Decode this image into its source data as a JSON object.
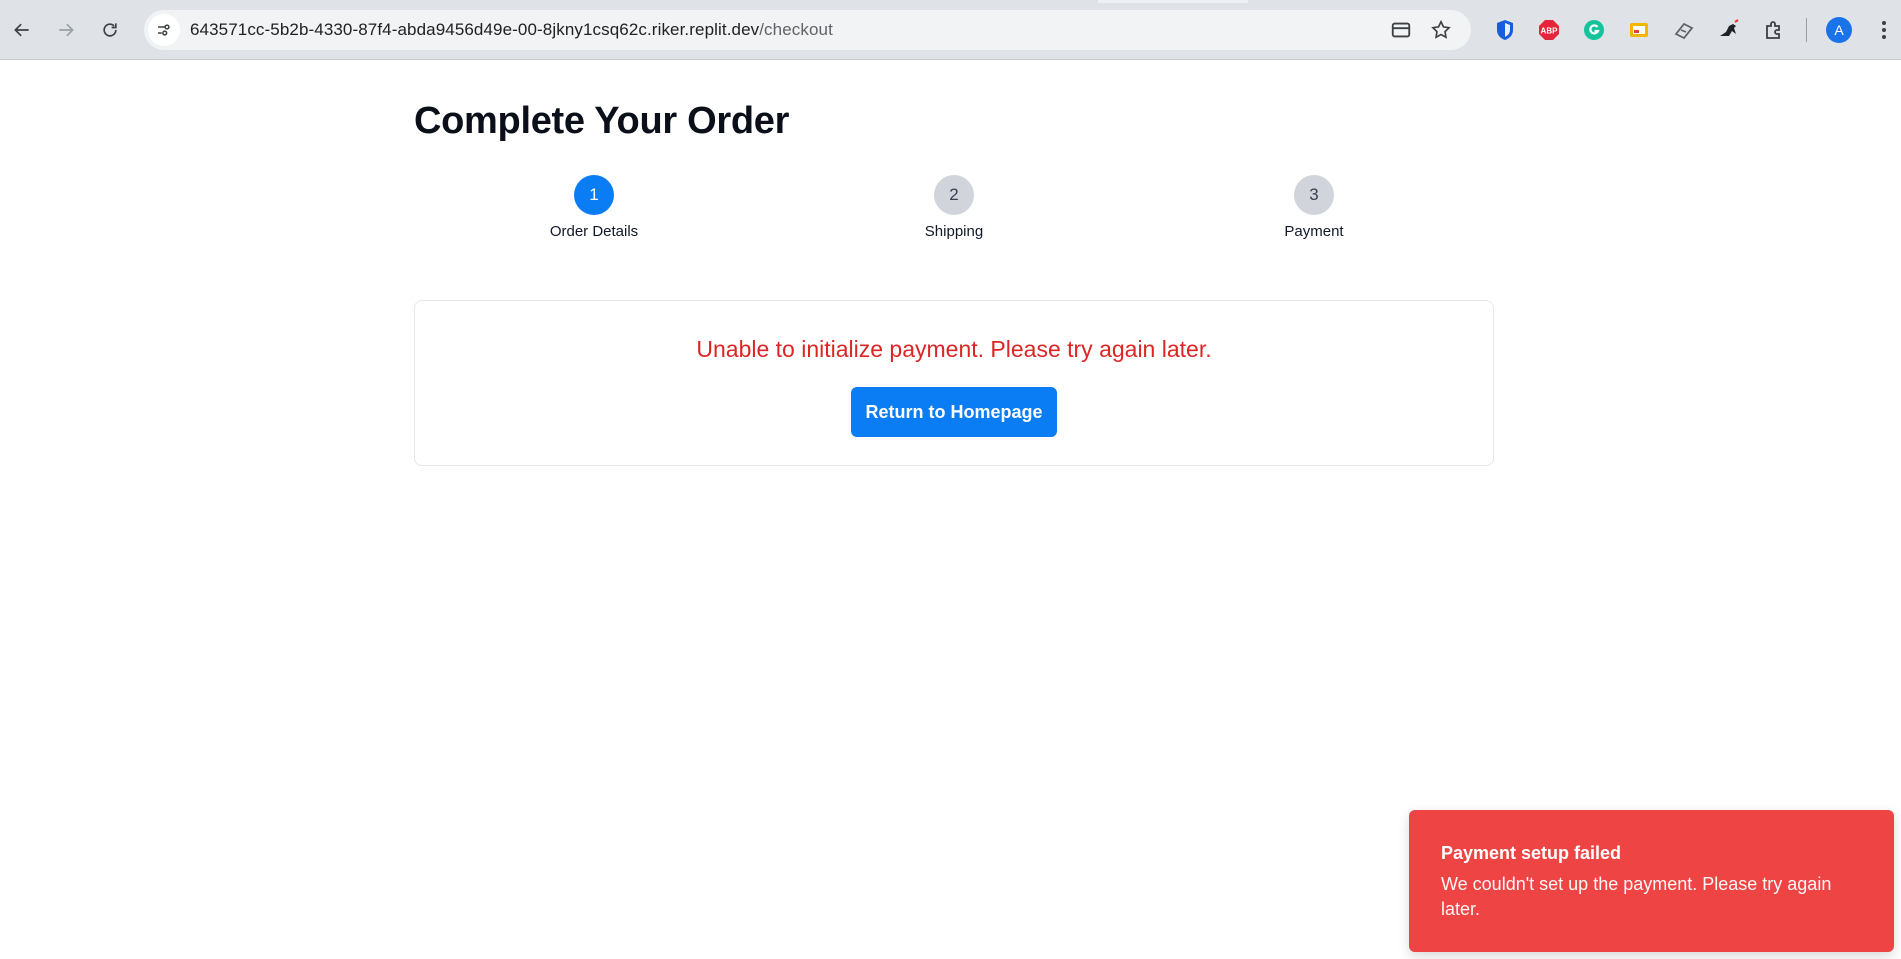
{
  "browser": {
    "url_host": "643571cc-5b2b-4330-87f4-abda9456d49e-00-8jkny1csq62c.riker.replit.dev",
    "url_path": "/checkout",
    "profile_initial": "A",
    "extensions": [
      "bitwarden-icon",
      "adblock-plus-icon",
      "grammarly-icon",
      "extension-slides-icon",
      "extension-tool-icon",
      "extension-bird-icon",
      "puzzle-icon"
    ]
  },
  "page": {
    "title": "Complete Your Order",
    "steps": [
      {
        "number": "1",
        "label": "Order Details",
        "active": true
      },
      {
        "number": "2",
        "label": "Shipping",
        "active": false
      },
      {
        "number": "3",
        "label": "Payment",
        "active": false
      }
    ],
    "error_message": "Unable to initialize payment. Please try again later.",
    "return_button_label": "Return to Homepage"
  },
  "toast": {
    "title": "Payment setup failed",
    "body": "We couldn't set up the payment. Please try again later."
  },
  "colors": {
    "accent": "#0a7cf4",
    "error_text": "#dc2626",
    "toast_bg": "#ef4444"
  }
}
